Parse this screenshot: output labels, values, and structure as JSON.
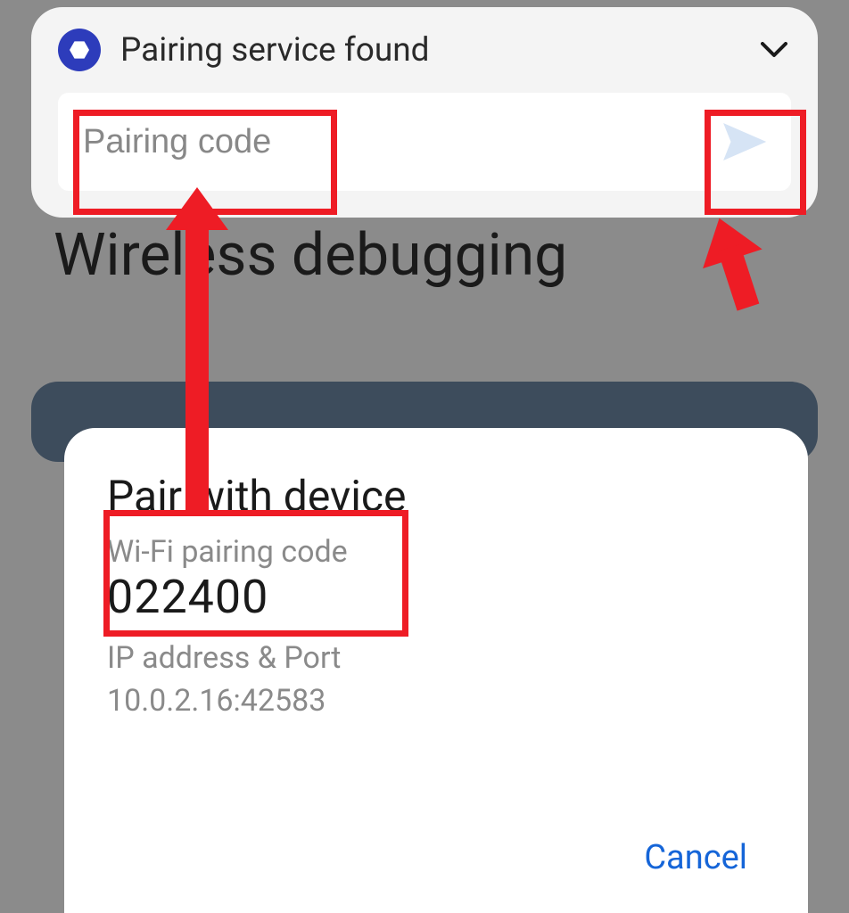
{
  "background": {
    "title": "Wireless debugging"
  },
  "notification": {
    "title": "Pairing service found",
    "input_placeholder": "Pairing code",
    "icon_name": "service-icon"
  },
  "dialog": {
    "title": "Pair with device",
    "code_label": "Wi-Fi pairing code",
    "code_value": "022400",
    "ip_label": "IP address & Port",
    "ip_value": "10.0.2.16:42583",
    "cancel_label": "Cancel"
  }
}
